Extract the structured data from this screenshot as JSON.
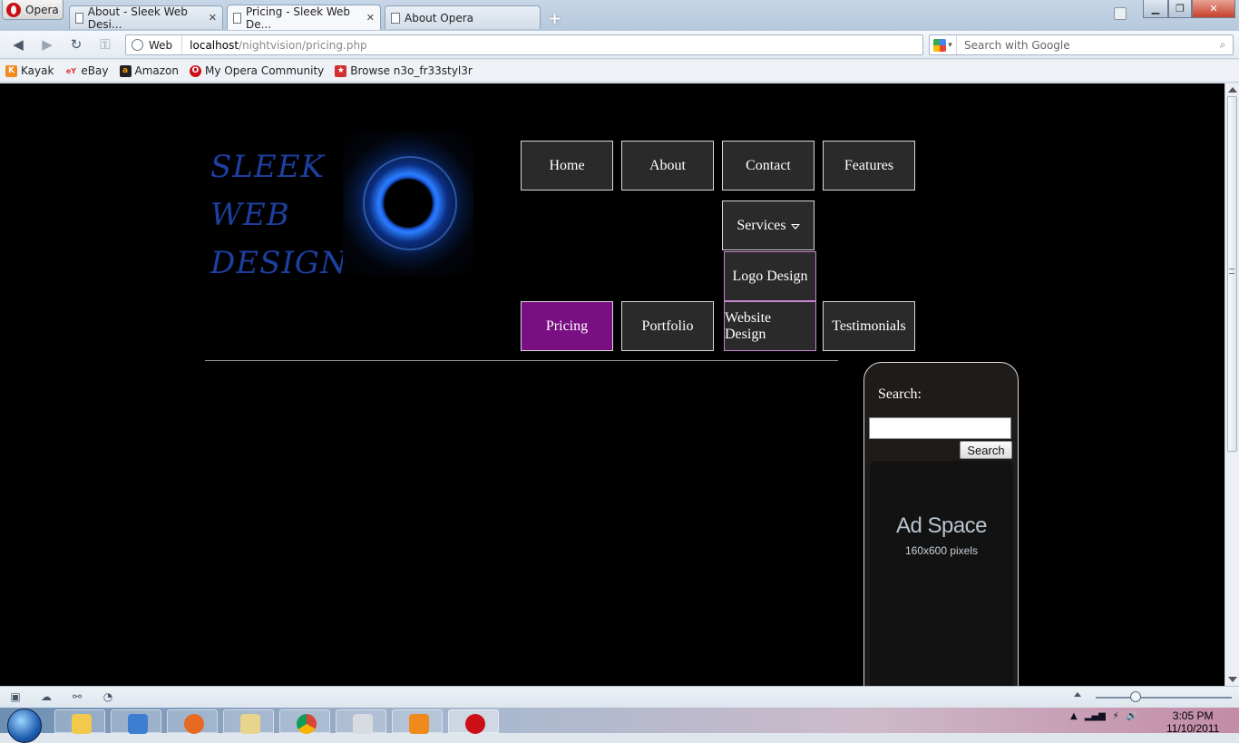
{
  "browser": {
    "menu_label": "Opera",
    "tabs": [
      {
        "title": "About - Sleek Web Desi...",
        "active": false
      },
      {
        "title": "Pricing - Sleek Web De...",
        "active": true
      },
      {
        "title": "About Opera",
        "active": false
      }
    ],
    "address": {
      "mode_label": "Web",
      "url_host": "localhost",
      "url_path": "/nightvision/pricing.php"
    },
    "search": {
      "placeholder": "Search with Google"
    },
    "bookmarks": [
      "Kayak",
      "eBay",
      "Amazon",
      "My Opera Community",
      "Browse n3o_fr33styl3r"
    ]
  },
  "page": {
    "logo": {
      "line1": "SLEEK",
      "line2": "WEB",
      "line3": "DESIGN"
    },
    "nav": {
      "home": "Home",
      "about": "About",
      "contact": "Contact",
      "features": "Features",
      "services": "Services",
      "services_dropdown": [
        "Logo Design",
        "Website Design"
      ],
      "pricing": "Pricing",
      "portfolio": "Portfolio",
      "testimonials": "Testimonials",
      "active_item": "Pricing"
    },
    "sidebar": {
      "search_label": "Search:",
      "search_value": "",
      "search_button": "Search",
      "ad_title": "Ad Space",
      "ad_size": "160x600 pixels"
    },
    "colors": {
      "active_nav": "#7a0f84",
      "logo_text": "#1d3fa0",
      "background": "#000000"
    }
  },
  "taskbar": {
    "time": "3:05 PM",
    "date": "11/10/2011"
  }
}
